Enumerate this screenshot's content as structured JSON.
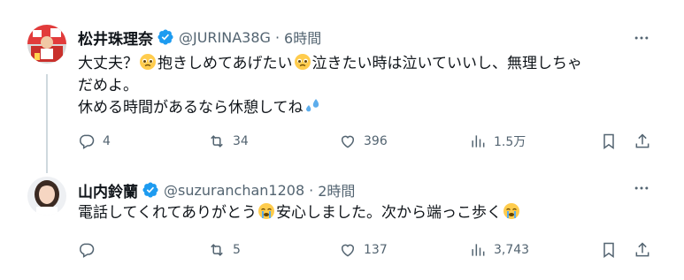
{
  "tweets": [
    {
      "name": "松井珠理奈",
      "handle": "@JURINA38G",
      "dot": "·",
      "time": "6時間",
      "lines": [
        "大丈夫？",
        "抱きしめてあげたい",
        "泣きたい時は泣いていいし、無理しちゃ",
        "だめよ。",
        "休める時間があるなら休憩してね"
      ],
      "replies": "4",
      "retweets": "34",
      "likes": "396",
      "views": "1.5万"
    },
    {
      "name": "山内鈴蘭",
      "handle": "@suzuranchan1208",
      "dot": "·",
      "time": "2時間",
      "lines": [
        "電話してくれてありがとう",
        "安心しました。次から端っこ歩く"
      ],
      "replies": "",
      "retweets": "5",
      "likes": "137",
      "views": "3,743"
    }
  ],
  "icons": {
    "verified": "verified-badge-icon",
    "more": "more-dots-icon",
    "reply": "reply-icon",
    "retweet": "retweet-icon",
    "like": "heart-icon",
    "views": "views-chart-icon",
    "bookmark": "bookmark-icon",
    "share": "share-icon"
  },
  "colors": {
    "verified": "#1d9bf0",
    "text": "#0f1419",
    "muted": "#536471",
    "divider": "#eff3f4"
  }
}
